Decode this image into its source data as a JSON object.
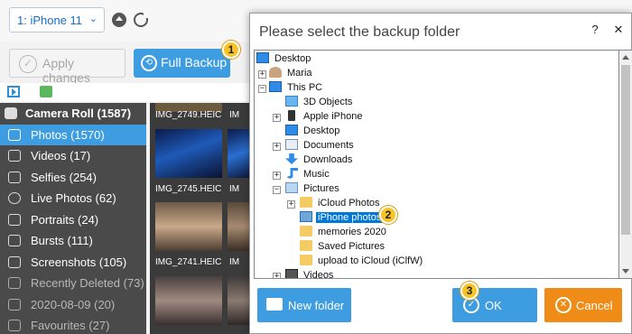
{
  "toolbar": {
    "device": "1: iPhone 11",
    "eject_icon": "eject-icon",
    "refresh_icon": "refresh-icon"
  },
  "actions": {
    "apply_label": "Apply changes",
    "full_backup_label": "Full Backup"
  },
  "steps": [
    "1",
    "2",
    "3"
  ],
  "sidebar": {
    "items": [
      {
        "label": "Camera Roll (1587)",
        "icon": "camera-icon"
      },
      {
        "label": "Photos (1570)",
        "icon": "photo-icon"
      },
      {
        "label": "Videos (17)",
        "icon": "video-icon"
      },
      {
        "label": "Selfies (254)",
        "icon": "selfie-icon"
      },
      {
        "label": "Live Photos (62)",
        "icon": "live-photo-icon"
      },
      {
        "label": "Portraits (24)",
        "icon": "portrait-icon"
      },
      {
        "label": "Bursts (111)",
        "icon": "burst-icon"
      },
      {
        "label": "Screenshots (105)",
        "icon": "screenshot-icon"
      },
      {
        "label": "Recently Deleted (73)",
        "icon": "trash-icon"
      },
      {
        "label": "2020-08-09 (20)",
        "icon": "album-icon"
      },
      {
        "label": "Favourites (27)",
        "icon": "album-icon"
      }
    ]
  },
  "grid": {
    "files": [
      "IMG_2749.HEIC",
      "IMG_2745.HEIC",
      "IMG_2741.HEIC"
    ],
    "files_col2": [
      "IM",
      "IM",
      "IM"
    ]
  },
  "dialog": {
    "title": "Please select the backup folder",
    "window_buttons": [
      "?",
      "✕"
    ],
    "tree": [
      {
        "label": "Desktop",
        "icon": "monitor-icon"
      },
      {
        "label": "Maria",
        "icon": "user-icon"
      },
      {
        "label": "This PC",
        "icon": "computer-icon"
      },
      {
        "label": "3D Objects",
        "icon": "cube-icon"
      },
      {
        "label": "Apple iPhone",
        "icon": "phone-icon"
      },
      {
        "label": "Desktop",
        "icon": "monitor-icon"
      },
      {
        "label": "Documents",
        "icon": "document-icon"
      },
      {
        "label": "Downloads",
        "icon": "download-icon"
      },
      {
        "label": "Music",
        "icon": "music-icon"
      },
      {
        "label": "Pictures",
        "icon": "pictures-icon"
      },
      {
        "label": "iCloud Photos",
        "icon": "folder-icon"
      },
      {
        "label": "iPhone photos",
        "icon": "folder-icon"
      },
      {
        "label": "memories 2020",
        "icon": "folder-icon"
      },
      {
        "label": "Saved Pictures",
        "icon": "folder-icon"
      },
      {
        "label": "upload to iCloud (iClfW)",
        "icon": "folder-icon"
      },
      {
        "label": "Videos",
        "icon": "video-folder-icon"
      }
    ],
    "selected": "iPhone photos",
    "new_folder_label": "New folder",
    "ok_label": "OK",
    "cancel_label": "Cancel"
  },
  "colors": {
    "accent": "#3d9de0",
    "cancel": "#ef8c17",
    "badge": "#f7c327",
    "sidebar_bg": "#4a4a4a",
    "selection": "#0078d7"
  }
}
